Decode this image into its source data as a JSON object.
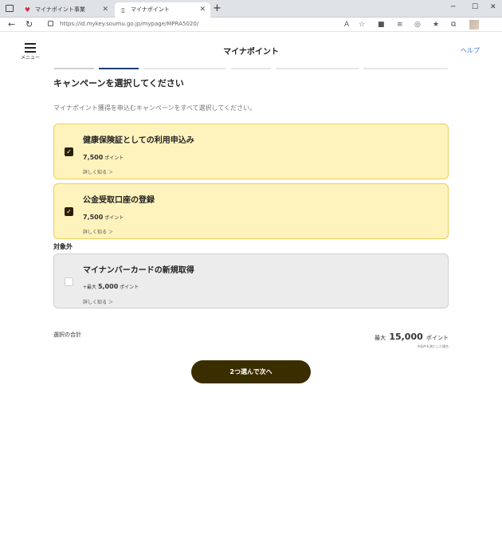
{
  "browser": {
    "tabs": [
      {
        "label": "マイナポイント事業",
        "active": false
      },
      {
        "label": "マイナポイント",
        "active": true
      }
    ],
    "url": "https://id.mykey.soumu.go.jp/mypage/MPRA5020/"
  },
  "header": {
    "menu_label": "メニュー",
    "title": "マイナポイント",
    "help_label": "ヘルプ"
  },
  "progress": {
    "total_steps": 6,
    "current_step": 2
  },
  "main": {
    "heading": "キャンペーンを選択してください",
    "subtext": "マイナポイント獲得を申込むキャンペーンをすべて選択してください。",
    "excluded_label": "対象外",
    "campaigns": [
      {
        "title": "健康保険証としての利用申込み",
        "prefix": "",
        "points": "7,500",
        "unit": "ポイント",
        "link": "詳しく知る ＞",
        "checked": true
      },
      {
        "title": "公金受取口座の登録",
        "prefix": "",
        "points": "7,500",
        "unit": "ポイント",
        "link": "詳しく知る ＞",
        "checked": true
      },
      {
        "title": "マイナンバーカードの新規取得",
        "prefix": "+最大",
        "points": "5,000",
        "unit": "ポイント",
        "link": "詳しく知る ＞",
        "checked": false
      }
    ],
    "summary": {
      "label": "選択の合計",
      "prefix": "最大",
      "total": "15,000",
      "unit": "ポイント",
      "note": "※条件を満たした場合"
    },
    "next_button": "2つ選んで次へ"
  },
  "colors": {
    "selected_bg": "#fff3bd",
    "selected_border": "#e9cf59",
    "disabled_bg": "#ececec",
    "button_bg": "#3a2d00",
    "progress_active": "#1e3f7a",
    "link": "#3a7bd5"
  }
}
